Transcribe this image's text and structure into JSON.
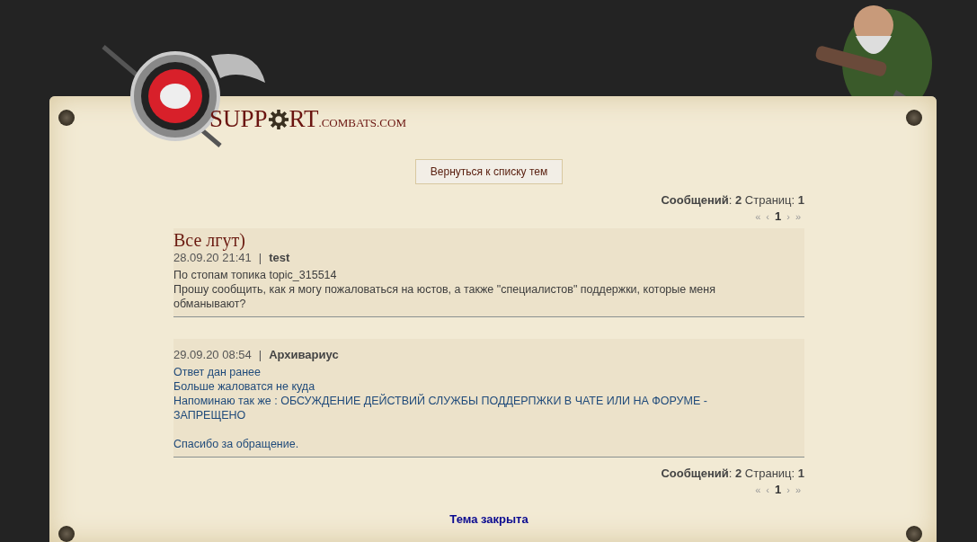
{
  "logo": {
    "first": "SUPP",
    "second": "RT",
    "domain": ".COMBATS.COM"
  },
  "back_button": "Вернуться к списку тем",
  "summary_top": "**Сообщений**: **2** Страниц: **1**",
  "pager_top": [
    {
      "label": "«",
      "selected": false
    },
    {
      "label": "‹",
      "selected": false
    },
    {
      "label": "1",
      "selected": true
    },
    {
      "label": "›",
      "selected": false
    },
    {
      "label": "»",
      "selected": false
    }
  ],
  "topic_title": "Все лгут)",
  "posts": [
    {
      "kind": "question",
      "date": "28.09.20 21:41",
      "separator": "|",
      "author": "test",
      "paragraphs": [
        [
          "По стопам топика topic_315514",
          "Прошу сообщить, как я могу пожаловаться на юстов, а также \"специалистов\" поддержки, которые меня обманывают?"
        ]
      ]
    },
    {
      "kind": "answer",
      "date": "29.09.20 08:54",
      "separator": "|",
      "author": "Архивариус",
      "paragraphs": [
        [
          "Ответ дан ранее",
          "Больше жаловатся не куда",
          "Напоминаю так же : ОБСУЖДЕНИЕ ДЕЙСТВИЙ СЛУЖБЫ ПОДДЕРПЖКИ В ЧАТЕ ИЛИ НА ФОРУМЕ - ЗАПРЕЩЕНО"
        ],
        [
          "Спасибо за обращение."
        ]
      ]
    }
  ],
  "summary_bottom": "**Сообщений**: **2** Страниц: **1**",
  "pager_bottom": [
    {
      "label": "«",
      "selected": false
    },
    {
      "label": "‹",
      "selected": false
    },
    {
      "label": "1",
      "selected": true
    },
    {
      "label": "›",
      "selected": false
    },
    {
      "label": "»",
      "selected": false
    }
  ],
  "closed_notice": "Тема закрыта"
}
